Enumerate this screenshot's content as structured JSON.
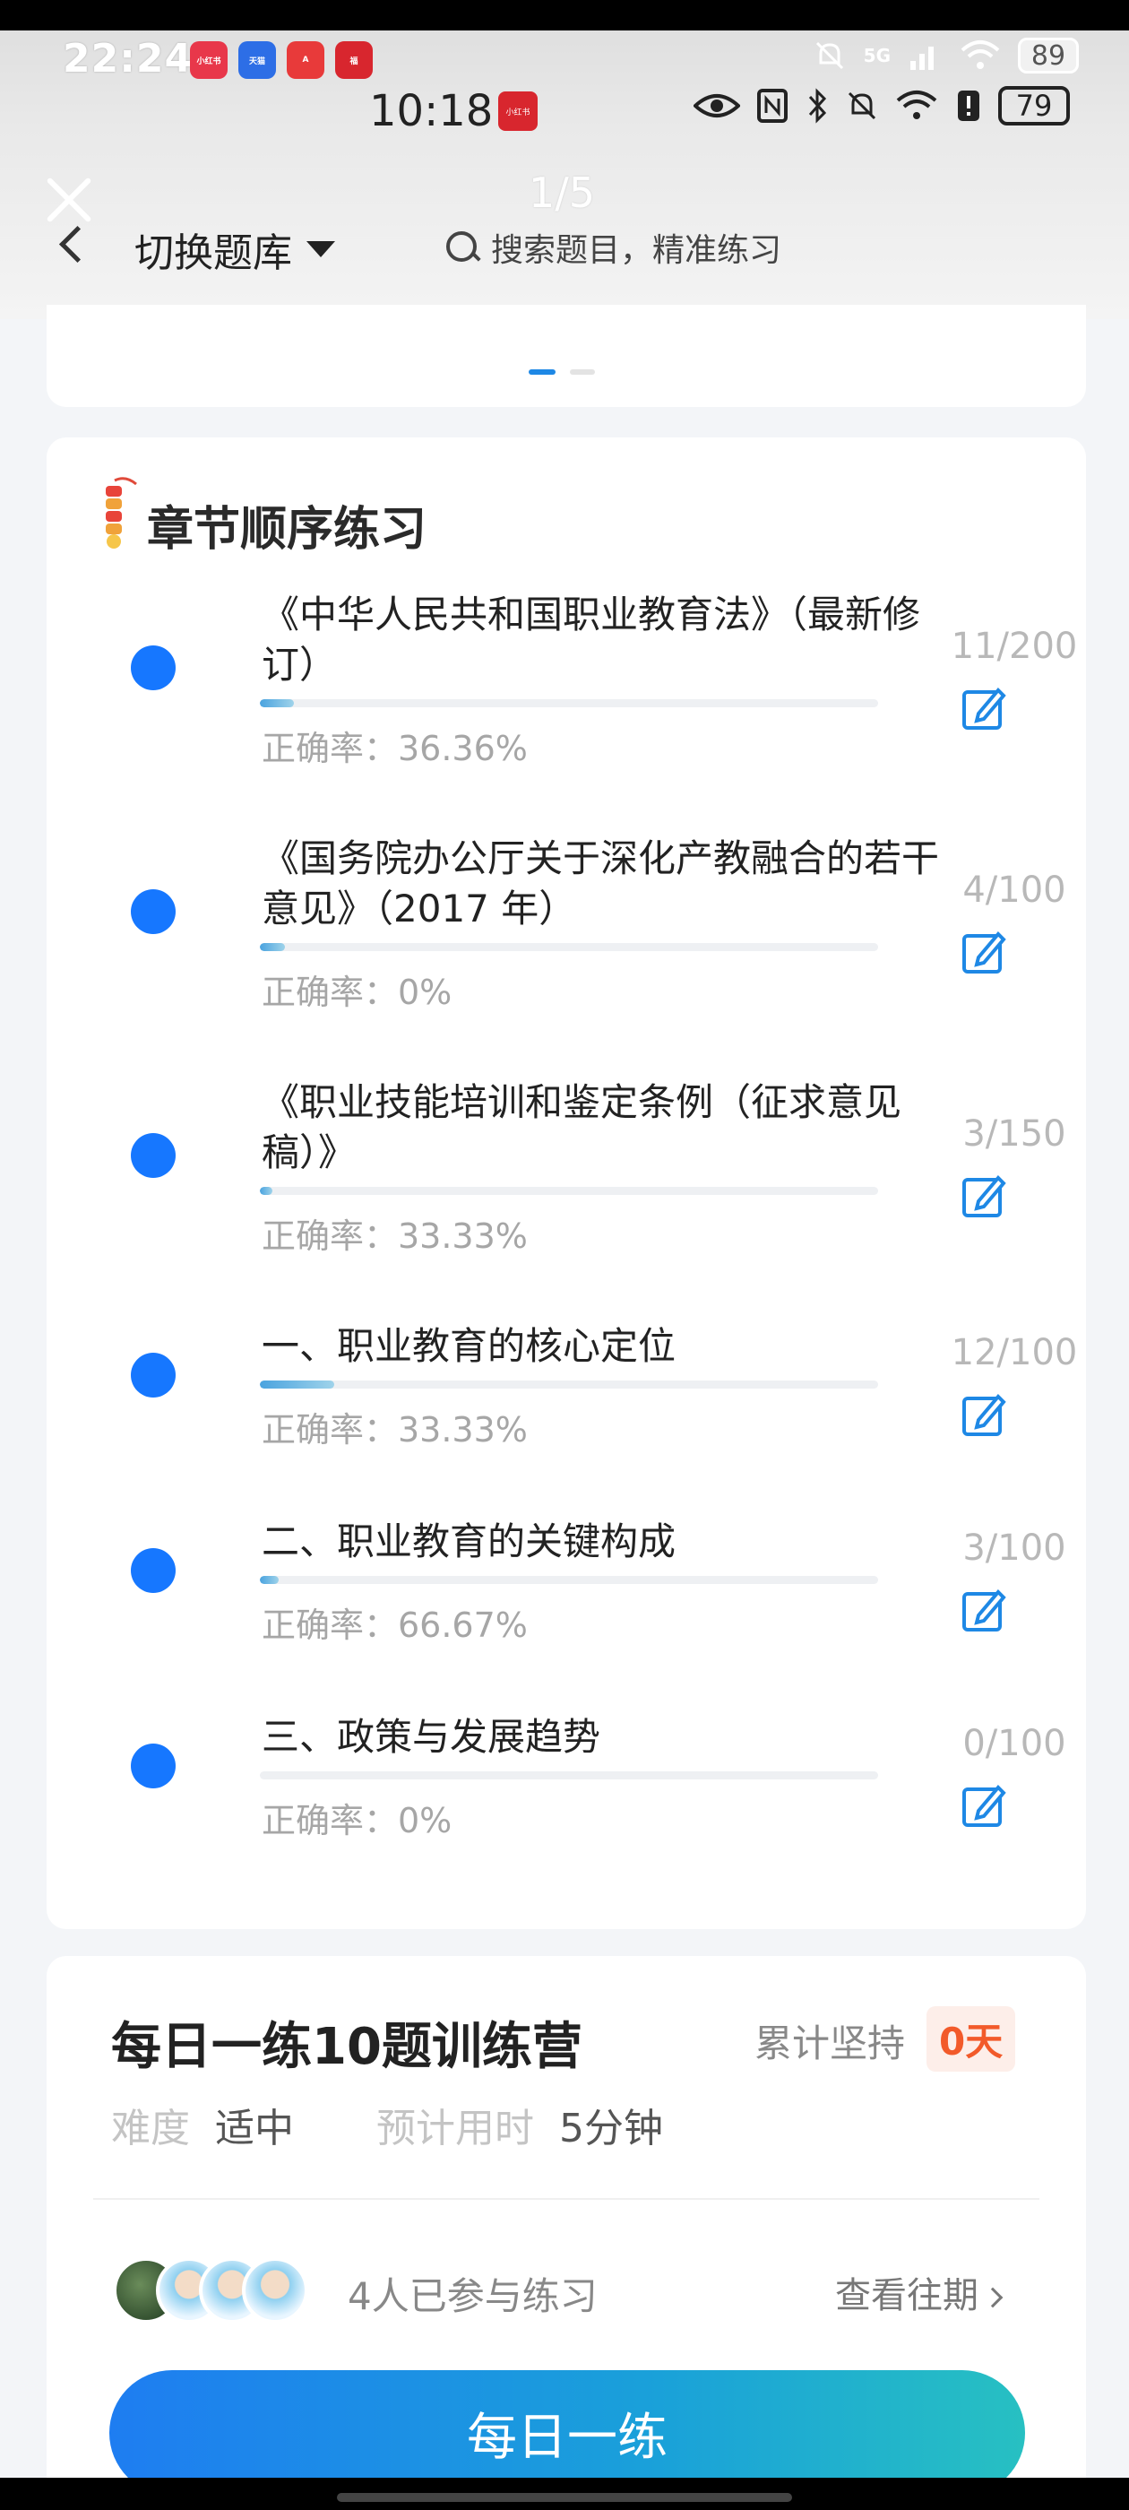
{
  "status_top": {
    "time": "22:24",
    "apps": [
      "小红书",
      "天猫",
      "A",
      "福"
    ],
    "network": "5G",
    "battery": "89"
  },
  "status_inner": {
    "time": "10:18",
    "app": "小红书",
    "battery": "79"
  },
  "overlay": {
    "pager": "1/5"
  },
  "header": {
    "switch_label": "切换题库",
    "search_placeholder": "搜索题目，精准练习"
  },
  "chapter_section": {
    "title": "章节顺序练习",
    "items": [
      {
        "title": "《中华人民共和国职业教育法》（最新修订）",
        "count": "11/200",
        "progress": 0.055,
        "rate": "正确率：36.36%"
      },
      {
        "title": "《国务院办公厅关于深化产教融合的若干意见》（2017 年）",
        "count": "4/100",
        "progress": 0.04,
        "rate": "正确率：0%"
      },
      {
        "title": "《职业技能培训和鉴定条例（征求意见稿）》",
        "count": "3/150",
        "progress": 0.02,
        "rate": "正确率：33.33%"
      },
      {
        "title": "一、职业教育的核心定位",
        "count": "12/100",
        "progress": 0.12,
        "rate": "正确率：33.33%"
      },
      {
        "title": "二、职业教育的关键构成",
        "count": "3/100",
        "progress": 0.03,
        "rate": "正确率：66.67%"
      },
      {
        "title": "三、政策与发展趋势",
        "count": "0/100",
        "progress": 0,
        "rate": "正确率：0%"
      }
    ]
  },
  "daily": {
    "title": "每日一练10题训练营",
    "persist_label": "累计坚持",
    "persist_days": "0天",
    "difficulty_label": "难度",
    "difficulty_value": "适中",
    "time_label": "预计用时",
    "time_value": "5分钟",
    "participants": "4人已参与练习",
    "history_link": "查看往期",
    "button": "每日一练"
  },
  "colors": {
    "accent": "#1677ff",
    "days_badge": "#f25a2a",
    "button_start": "#1e7df1",
    "button_end": "#27c0c2"
  }
}
